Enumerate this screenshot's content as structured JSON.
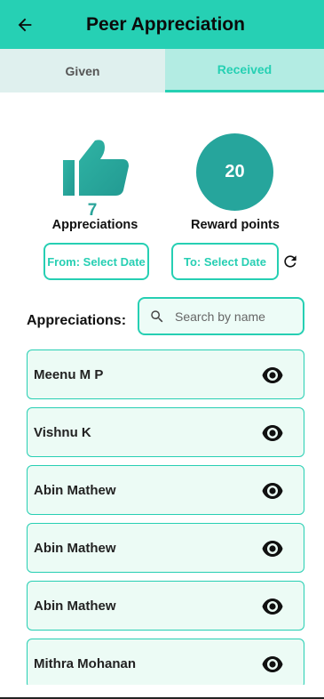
{
  "header": {
    "title": "Peer Appreciation",
    "back_icon": "arrow-left-icon"
  },
  "tabs": [
    {
      "label": "Given",
      "active": false
    },
    {
      "label": "Received",
      "active": true
    }
  ],
  "summary": {
    "appreciations_count": "7",
    "appreciations_label": "Appreciations",
    "reward_points": "20",
    "reward_points_label": "Reward points"
  },
  "filters": {
    "from_label": "From: Select Date",
    "to_label": "To: Select Date",
    "refresh_icon": "refresh-icon"
  },
  "list": {
    "heading": "Appreciations:",
    "search_placeholder": "Search by name",
    "search_value": "",
    "items": [
      {
        "name": "Meenu M P"
      },
      {
        "name": "Vishnu K"
      },
      {
        "name": "Abin Mathew"
      },
      {
        "name": "Abin Mathew"
      },
      {
        "name": "Abin Mathew"
      },
      {
        "name": "Mithra Mohanan"
      }
    ]
  },
  "colors": {
    "accent": "#26d0b4",
    "teal_dark": "#26a59c",
    "item_bg": "#ecfbf5"
  }
}
